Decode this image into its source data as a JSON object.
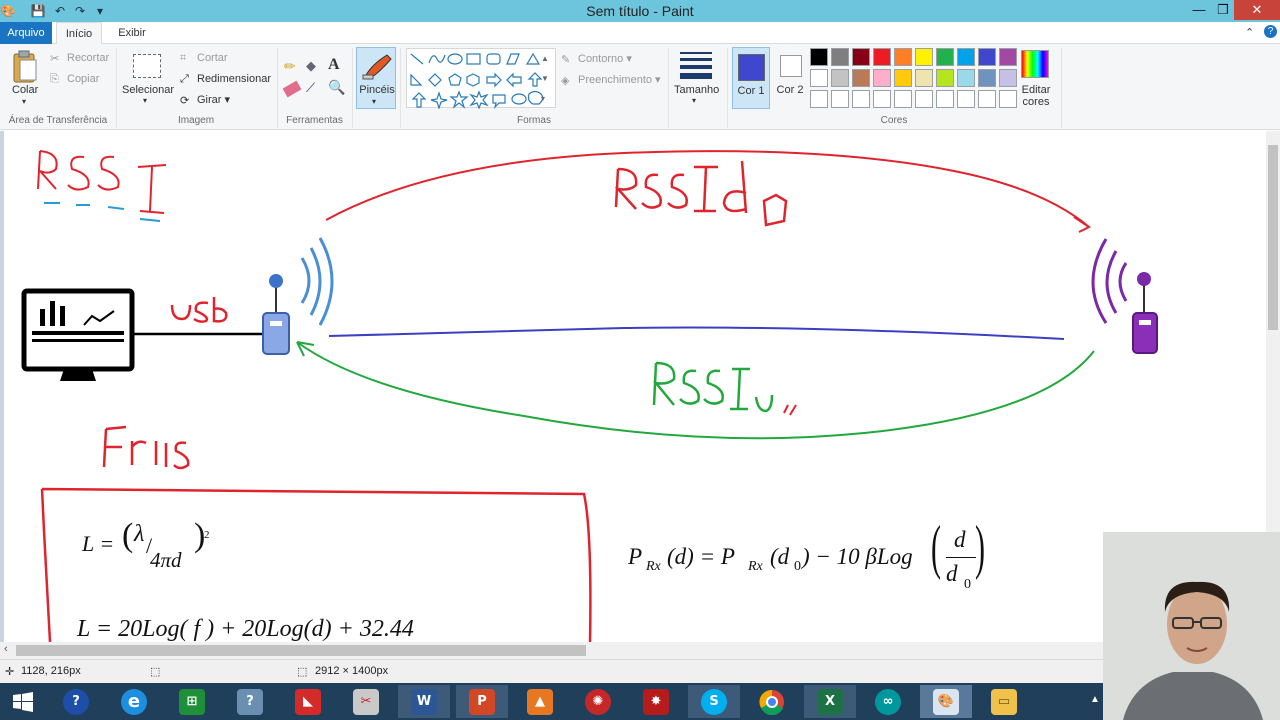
{
  "window": {
    "title": "Sem título - Paint",
    "controls": {
      "minimize": "—",
      "maximize": "❐",
      "close": "✕"
    }
  },
  "menu": {
    "file": "Arquivo",
    "home": "Início",
    "view": "Exibir"
  },
  "ribbon": {
    "clipboard": {
      "label": "Área de Transferência",
      "paste": "Colar",
      "cut": "Recortar",
      "copy": "Copiar"
    },
    "image": {
      "label": "Imagem",
      "select": "Selecionar",
      "crop": "Cortar",
      "resize": "Redimensionar",
      "rotate": "Girar"
    },
    "tools": {
      "label": "Ferramentas"
    },
    "brushes": {
      "label": "Pincéis"
    },
    "shapes": {
      "label": "Formas",
      "outline": "Contorno",
      "fill": "Preenchimento"
    },
    "size": {
      "label": "Tamanho"
    },
    "colors": {
      "label": "Cores",
      "color1": "Cor 1",
      "color2": "Cor 2",
      "edit": "Editar cores",
      "color1_value": "#3f48cc",
      "color2_value": "#ffffff",
      "palette_row1": [
        "#000000",
        "#7f7f7f",
        "#880015",
        "#ed1c24",
        "#ff7f27",
        "#fff200",
        "#22b14c",
        "#00a2e8",
        "#3f48cc",
        "#a349a4"
      ],
      "palette_row2": [
        "#ffffff",
        "#c3c3c3",
        "#b97a57",
        "#ffaec9",
        "#ffc90e",
        "#efe4b0",
        "#b5e61d",
        "#99d9ea",
        "#7092be",
        "#c8bfe7"
      ]
    }
  },
  "drawing": {
    "rssi_heading": "RSSI",
    "rssi_d0": "RSSI d0",
    "usb": "usb",
    "rssi_bottom": "RSSIu,,",
    "friis": "Friis",
    "formula_loss_left": "L =",
    "formula_loss_lambda": "λ",
    "formula_loss_den": "4πd",
    "formula_loss_exp": "2",
    "formula_loss_log": "L = 20Log( f ) + 20Log(d) + 32.44",
    "formula_prx_left": "P",
    "formula_prx_sub": "Rx",
    "formula_prx_mid": "(d) = P",
    "formula_prx_mid2": "(d",
    "formula_prx_mid3": ") − 10 βLog",
    "formula_prx_zero": "0",
    "formula_prx_frac_num": "d",
    "formula_prx_frac_den": "d"
  },
  "status": {
    "cursor": "1128, 216px",
    "image_size": "2912 × 1400px"
  },
  "taskbar": {
    "apps": [
      "windows-start",
      "help",
      "internet-explorer",
      "project",
      "support",
      "app-red",
      "snipping",
      "word",
      "powerpoint",
      "matlab",
      "app-wheel",
      "app-star",
      "skype",
      "chrome",
      "excel",
      "arduino",
      "paint",
      "file-explorer"
    ]
  }
}
